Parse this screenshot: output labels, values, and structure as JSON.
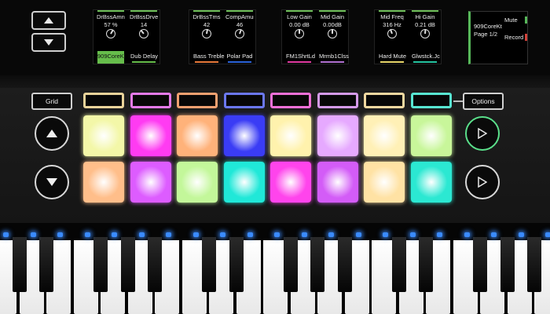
{
  "nav": {
    "up_icon": "up-arrow-icon",
    "down_icon": "down-arrow-icon"
  },
  "screens": [
    {
      "controls": [
        {
          "name": "DrBssAmnt",
          "value": "57 %",
          "bar": "#6fbf5a",
          "angle": 30,
          "label": "909CoreKt",
          "label_bg": "#66bd4b",
          "label_ul": ""
        },
        {
          "name": "DrBssDrve",
          "value": "14",
          "bar": "#6fbf5a",
          "angle": -40,
          "label": "Dub Delay",
          "label_bg": "",
          "label_ul": "#66bd4b"
        }
      ]
    },
    {
      "controls": [
        {
          "name": "DrBssTms",
          "value": "42",
          "bar": "#6fbf5a",
          "angle": 10,
          "label": "Bass Treble",
          "label_bg": "",
          "label_ul": "#e6793a"
        },
        {
          "name": "CompAmun",
          "value": "46",
          "bar": "#6fbf5a",
          "angle": 20,
          "label": "Polar Pad",
          "label_bg": "",
          "label_ul": "#2b63d9"
        }
      ]
    },
    {
      "controls": [
        {
          "name": "Low Gain",
          "value": "0.00 dB",
          "bar": "#6fbf5a",
          "angle": 0,
          "label": "FM1ShrtLd",
          "label_bg": "",
          "label_ul": "#e03aa0"
        },
        {
          "name": "Mid Gain",
          "value": "0.00dB",
          "bar": "#6fbf5a",
          "angle": 0,
          "label": "Mrmb1Clss",
          "label_bg": "",
          "label_ul": "#b070d0"
        }
      ]
    },
    {
      "controls": [
        {
          "name": "Mid Freq",
          "value": "316 Hz",
          "bar": "#6fbf5a",
          "angle": -20,
          "label": "Hard Mute",
          "label_bg": "",
          "label_ul": "#e8d66a"
        },
        {
          "name": "Hi Gain",
          "value": "0.21 dB",
          "bar": "#6fbf5a",
          "angle": 5,
          "label": "Glwstck.Jc",
          "label_bg": "",
          "label_ul": "#26c4a0"
        }
      ]
    }
  ],
  "channel": {
    "track": "909CoreKt",
    "page": "Page 1/2",
    "mute": "Mute",
    "record": "Record",
    "mute_color": "#57b85a",
    "record_color": "#d2423a"
  },
  "grid_button": {
    "label": "Grid"
  },
  "options_button": {
    "label": "Options"
  },
  "scene_buttons": [
    {
      "color": "#e9d39a"
    },
    {
      "color": "#e47ae8"
    },
    {
      "color": "#f0a070"
    },
    {
      "color": "#6b78f0"
    },
    {
      "color": "#f070d8"
    },
    {
      "color": "#d49ae8"
    },
    {
      "color": "#f0d8a0"
    },
    {
      "color": "#58e6d2"
    }
  ],
  "pad_rows": [
    [
      "#f3f7a8",
      "#ff3bf2",
      "#ffb27a",
      "#3a3cf5",
      "#fff2ad",
      "#e6a9ff",
      "#fff0b6",
      "#c8f69a"
    ],
    [
      "#ffbe8a",
      "#dd5cff",
      "#c3f79a",
      "#20e8d8",
      "#ff44ec",
      "#d35cf7",
      "#ffe2a4",
      "#2be8d2"
    ]
  ],
  "side_buttons": {
    "up": "up-arrow-icon",
    "down": "down-arrow-icon"
  },
  "play_buttons": [
    {
      "color": "#5adf8a"
    },
    {
      "color": "#d8d8d8"
    }
  ]
}
